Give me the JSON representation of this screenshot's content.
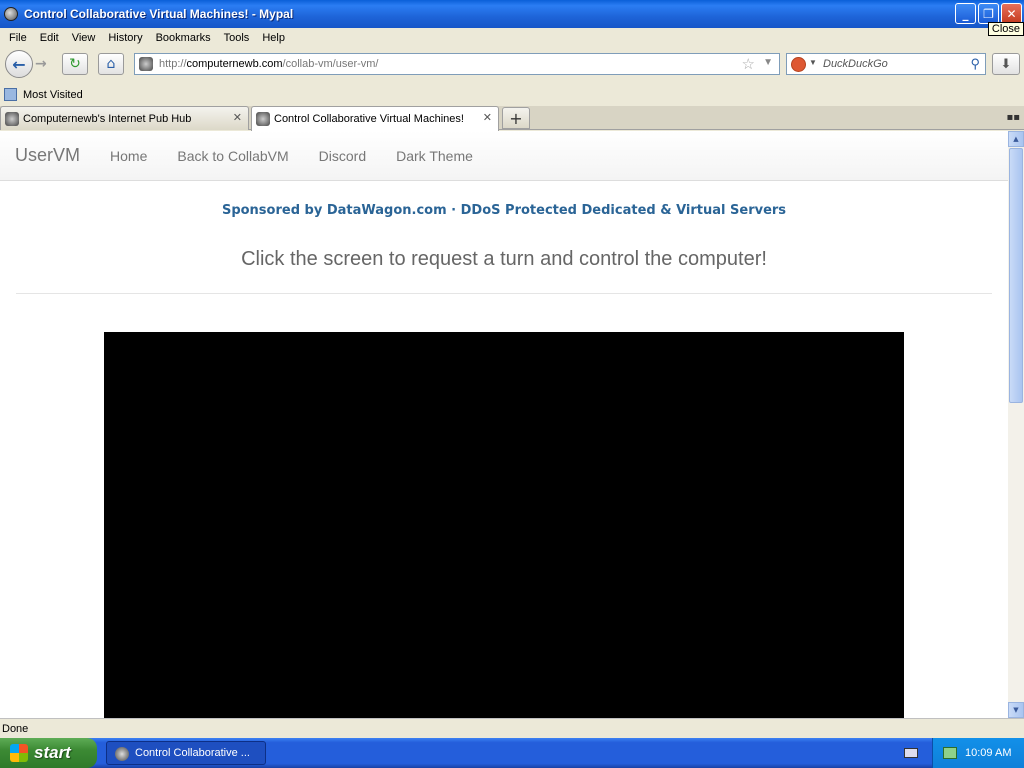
{
  "window": {
    "title": "Control Collaborative Virtual Machines! - Mypal",
    "close_tooltip": "Close"
  },
  "menu": [
    "File",
    "Edit",
    "View",
    "History",
    "Bookmarks",
    "Tools",
    "Help"
  ],
  "nav": {
    "url_prefix": "http://",
    "url_host": "computernewb.com",
    "url_path": "/collab-vm/user-vm/",
    "search_placeholder": "DuckDuckGo"
  },
  "bookmarks": {
    "most_visited": "Most Visited"
  },
  "tabs": [
    {
      "label": "Computernewb's Internet Pub Hub"
    },
    {
      "label": "Control Collaborative Virtual Machines!"
    }
  ],
  "page": {
    "brand": "UserVM",
    "nav_links": [
      "Home",
      "Back to CollabVM",
      "Discord",
      "Dark Theme"
    ],
    "sponsor": "Sponsored by DataWagon.com · DDoS Protected Dedicated & Virtual Servers",
    "instructions": "Click the screen to request a turn and control the computer!"
  },
  "status": {
    "text": "Done"
  },
  "taskbar": {
    "start_label": "start",
    "task_item": "Control Collaborative ...",
    "clock": "10:09 AM"
  },
  "colors": {
    "title_bar": "#1e64d8",
    "sponsor_link": "#2a6496",
    "vm_screen": "#000000"
  }
}
